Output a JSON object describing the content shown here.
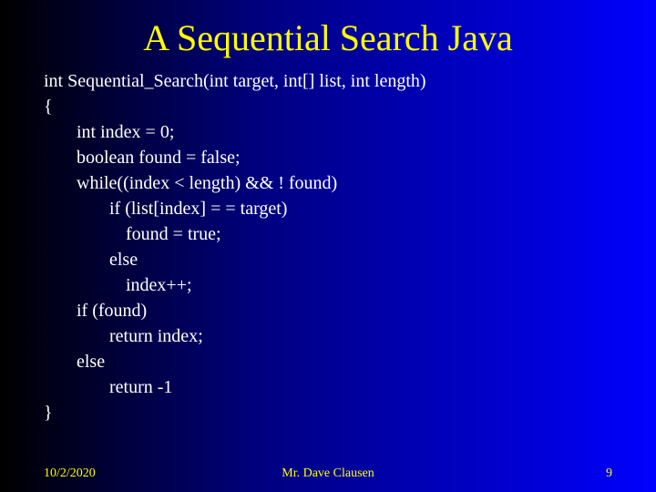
{
  "slide": {
    "title": "A Sequential Search Java",
    "code": {
      "signature": "int Sequential_Search(int target, int[] list, int length)",
      "open_brace": "{",
      "l1": "int index = 0;",
      "l2": "boolean found = false;",
      "l3": "while((index < length) && ! found)",
      "l4": "if (list[index] = = target)",
      "l5": "found = true;",
      "l6": "else",
      "l7": "index++;",
      "l8": "if (found)",
      "l9": "return index;",
      "l10": "else",
      "l11": "return -1",
      "close_brace": "}"
    },
    "footer": {
      "date": "10/2/2020",
      "author": "Mr. Dave Clausen",
      "page": "9"
    }
  }
}
